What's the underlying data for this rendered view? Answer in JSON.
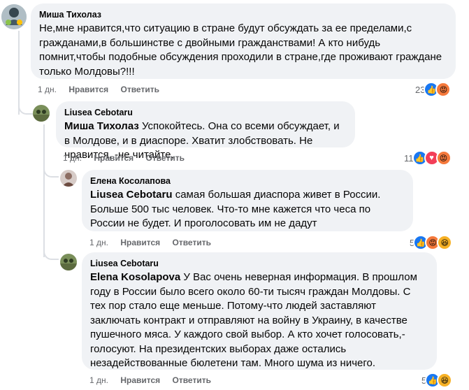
{
  "comments": [
    {
      "author": "Миша Тихолаз",
      "mention": "",
      "text": "Не,мне нравится,что ситуацию в стране будут обсуждать за ее пределами,с гражданами,в большинстве с двойными гражданствами! А кто нибудь помнит,чтобы подобные обсуждения проходили в стране,где проживают граждане только Молдовы?!!!",
      "time": "1 дн.",
      "like_label": "Нравится",
      "reply_label": "Ответить",
      "reaction_count": "23",
      "reactions": [
        "like-icon",
        "angry-icon"
      ]
    },
    {
      "author": "Liusea Cebotaru",
      "mention": "Миша Тихолаз",
      "text": " Успокойтесь. Она со всеми обсуждает, и в Молдове, и в диаспоре. Хватит злобствовать. Не нравится, -не читайте.",
      "time": "1 дн.",
      "like_label": "Нравится",
      "reply_label": "Ответить",
      "reaction_count": "11",
      "reactions": [
        "like-icon",
        "heart-icon",
        "angry-icon"
      ]
    },
    {
      "author": "Елена Косолапова",
      "mention": "Liusea Cebotaru",
      "text": " самая большая диаспора живет в России. Больше 500 тыс человек. Что-то мне кажется что чеса по России не будет. И проголосовать им не дадут",
      "time": "1 дн.",
      "like_label": "Нравится",
      "reply_label": "Ответить",
      "reaction_count": "5",
      "reactions": [
        "like-icon",
        "angry-icon",
        "haha-icon"
      ]
    },
    {
      "author": "Liusea Cebotaru",
      "mention": "Elena Kosolapova",
      "text": " У Вас очень неверная информация. В прошлом году в России было всего около 60-ти тысяч граждан Молдовы. С тех пор стало еще меньше. Потому-что людей заставляют заключать контракт и отправляют на войну в Украину, в качестве пушечного мяса. У каждого свой выбор. А кто хочет голосовать,- голосуют. На президентских выборах даже остались незадействованные бюлетени там. Много шума из ничего.",
      "time": "1 дн.",
      "like_label": "Нравится",
      "reply_label": "Ответить",
      "reaction_count": "5",
      "reactions": [
        "like-icon",
        "haha-icon"
      ]
    }
  ],
  "colors": {
    "bubble": "#f0f2f5",
    "meta": "#65676b",
    "like": "#1877f2",
    "angry": "#f5793b",
    "heart": "#f33e58",
    "haha": "#f7b125"
  }
}
